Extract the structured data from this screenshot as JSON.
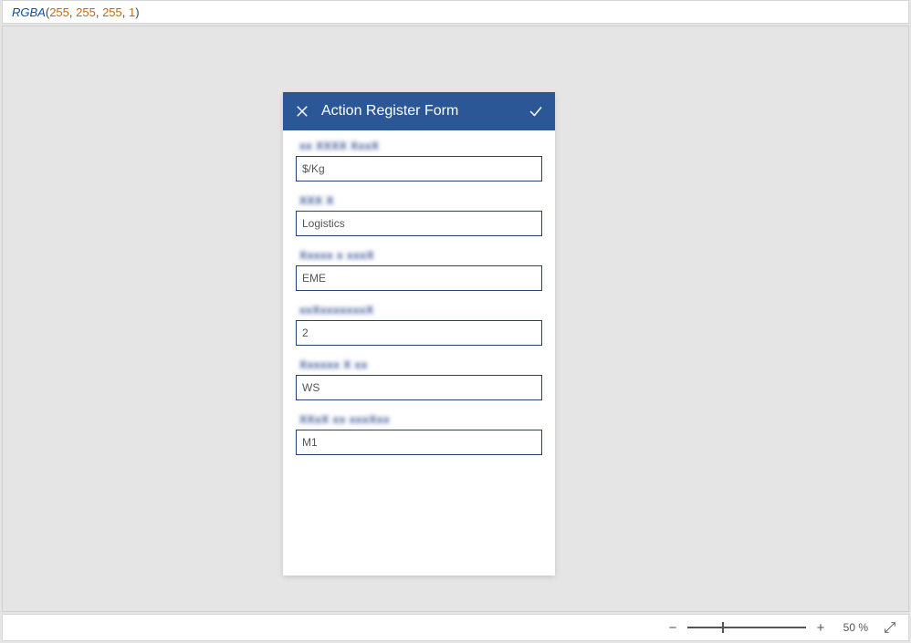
{
  "formula": {
    "fn": "RGBA",
    "r": "255",
    "g": "255",
    "b": "255",
    "a": "1"
  },
  "form": {
    "title": "Action Register Form",
    "fields": [
      {
        "label": "xx XXXX XxxX",
        "value": "$/Kg"
      },
      {
        "label": "XXX X",
        "value": "Logistics"
      },
      {
        "label": "Xxxxx x  xxxX",
        "value": "EME"
      },
      {
        "label": "xxXxxxxxxxX",
        "value": "2"
      },
      {
        "label": "Xxxxxx X xx",
        "value": "WS"
      },
      {
        "label": "XXxX xx xxxXxx",
        "value": "M1"
      }
    ]
  },
  "statusbar": {
    "zoom": "50 %"
  }
}
